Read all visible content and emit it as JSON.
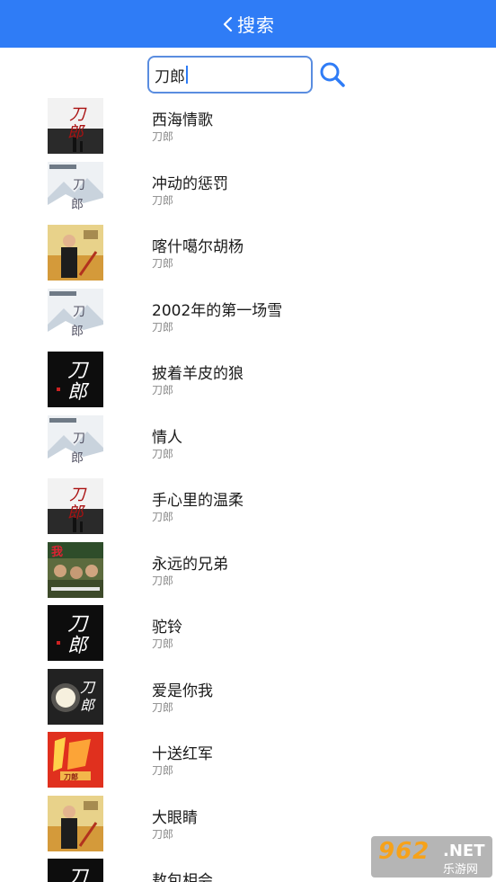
{
  "header": {
    "back_glyph": "back-chevron-icon",
    "title": "搜索"
  },
  "search": {
    "value": "刀郎",
    "button_icon": "search-icon"
  },
  "songs": [
    {
      "title": "西海情歌",
      "artist": "刀郎"
    },
    {
      "title": "冲动的惩罚",
      "artist": "刀郎"
    },
    {
      "title": "喀什噶尔胡杨",
      "artist": "刀郎"
    },
    {
      "title": "2002年的第一场雪",
      "artist": "刀郎"
    },
    {
      "title": "披着羊皮的狼",
      "artist": "刀郎"
    },
    {
      "title": "情人",
      "artist": "刀郎"
    },
    {
      "title": "手心里的温柔",
      "artist": "刀郎"
    },
    {
      "title": "永远的兄弟",
      "artist": "刀郎"
    },
    {
      "title": "驼铃",
      "artist": "刀郎"
    },
    {
      "title": "爱是你我",
      "artist": "刀郎"
    },
    {
      "title": "十送红军",
      "artist": "刀郎"
    },
    {
      "title": "大眼睛",
      "artist": "刀郎"
    },
    {
      "title": "敖包相会",
      "artist": ""
    }
  ],
  "watermark": {
    "number": "962",
    "net": ".NET",
    "site": "乐游网"
  },
  "colors": {
    "accent": "#2f7cf6",
    "search_border": "#5a8de0"
  }
}
